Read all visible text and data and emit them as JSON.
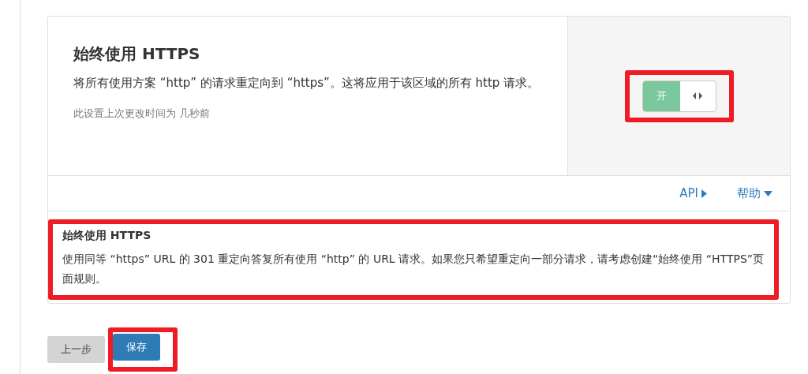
{
  "setting": {
    "title": "始终使用 HTTPS",
    "description": "将所有使用方案 “http” 的请求重定向到 “https”。这将应用于该区域的所有 http 请求。",
    "last_changed": "此设置上次更改时间为 几秒前",
    "toggle": {
      "label": "开",
      "on": true
    }
  },
  "links": [
    {
      "label": "API",
      "kind": "right"
    },
    {
      "label": "帮助",
      "kind": "down"
    }
  ],
  "help": {
    "title": "始终使用 HTTPS",
    "text": "使用同等 “https” URL 的 301 重定向答复所有使用 “http” 的 URL 请求。如果您只希望重定向一部分请求，请考虑创建“始终使用 “HTTPS”页面规则。"
  },
  "buttons": [
    {
      "label": "上一步",
      "kind": "secondary"
    },
    {
      "label": "保存",
      "kind": "primary"
    }
  ]
}
